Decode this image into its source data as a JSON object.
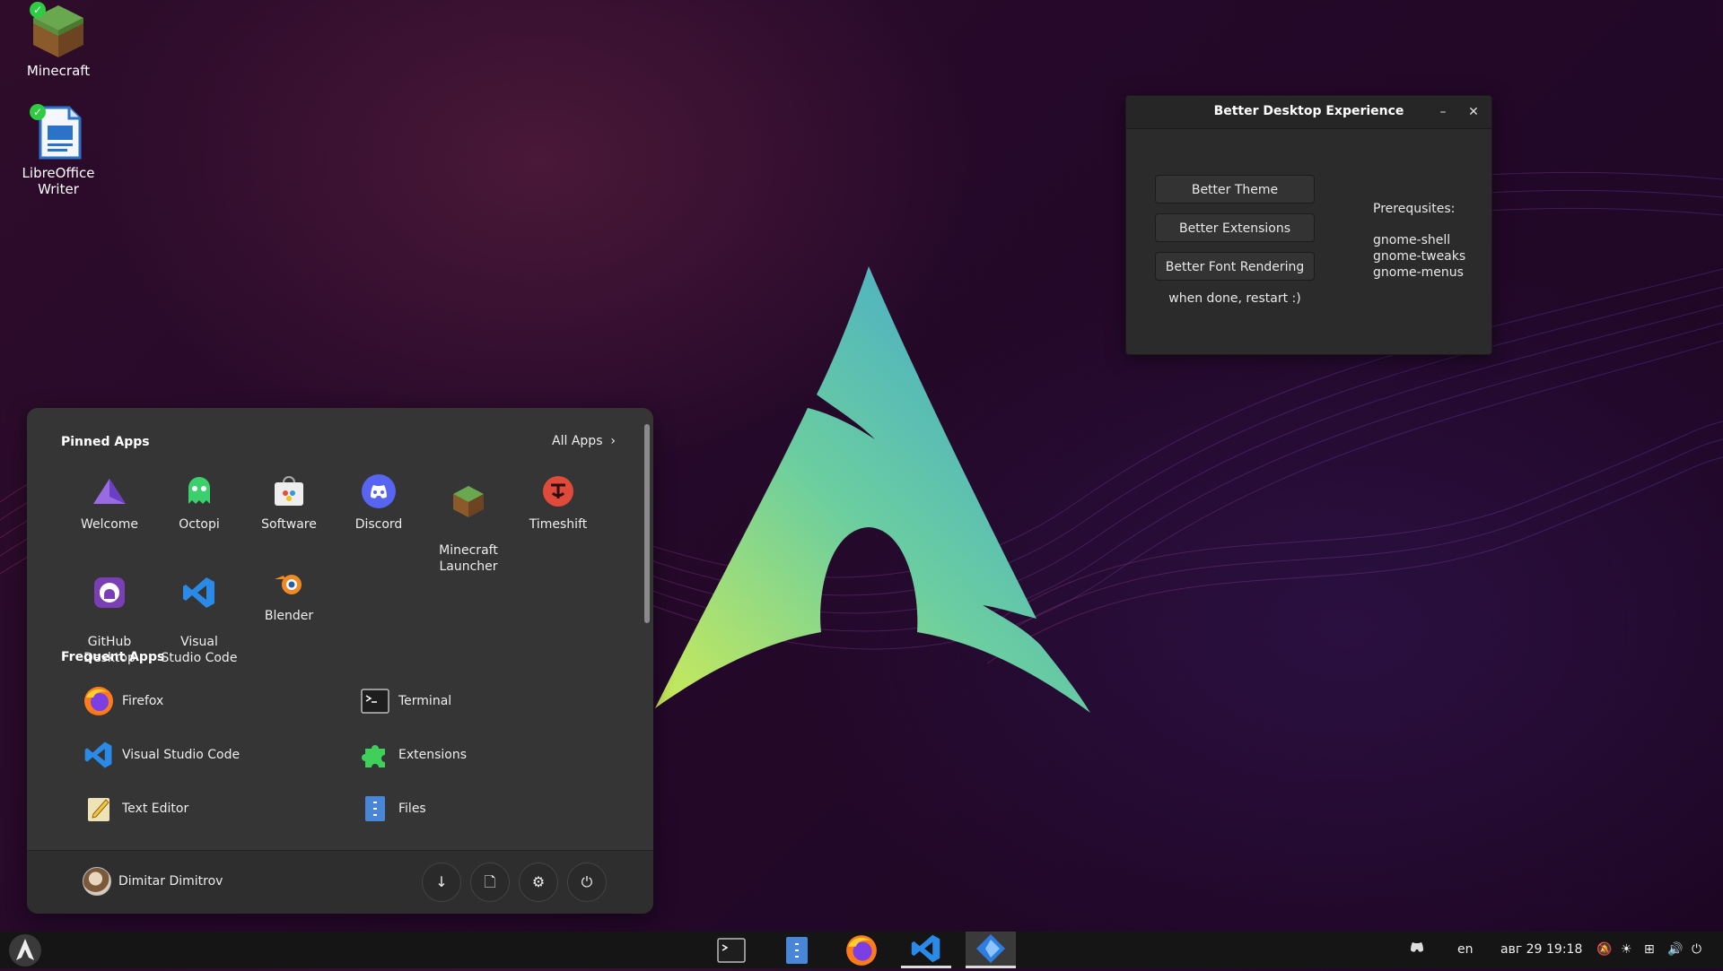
{
  "desktop": {
    "icons": [
      {
        "label": "Minecraft",
        "icon": "minecraft-grass-block-icon"
      },
      {
        "label": "LibreOffice Writer",
        "icon": "libreoffice-writer-icon"
      }
    ]
  },
  "dialog": {
    "title": "Better Desktop Experience",
    "minimize_label": "–",
    "close_label": "✕",
    "buttons": [
      "Better Theme",
      "Better Extensions",
      "Better Font Rendering"
    ],
    "note": "when done, restart :)",
    "prereq_title": "Prerequsites:",
    "prereqs": [
      "gnome-shell",
      "gnome-tweaks",
      "gnome-menus"
    ]
  },
  "menu": {
    "pinned_title": "Pinned Apps",
    "all_apps_label": "All Apps",
    "pinned": [
      {
        "label": "Welcome",
        "icon": "welcome-triangle-icon"
      },
      {
        "label": "Octopi",
        "icon": "octopi-icon"
      },
      {
        "label": "Software",
        "icon": "software-bag-icon"
      },
      {
        "label": "Discord",
        "icon": "discord-icon"
      },
      {
        "label": "Minecraft\nLauncher",
        "icon": "minecraft-icon"
      },
      {
        "label": "Timeshift",
        "icon": "timeshift-icon"
      },
      {
        "label": "GitHub\nDesktop",
        "icon": "github-icon"
      },
      {
        "label": "Visual\nStudio Code",
        "icon": "vscode-icon"
      },
      {
        "label": "Blender",
        "icon": "blender-icon"
      }
    ],
    "frequent_title": "Frequent Apps",
    "frequent": [
      {
        "label": "Firefox",
        "icon": "firefox-icon"
      },
      {
        "label": "Terminal",
        "icon": "terminal-icon"
      },
      {
        "label": "Visual Studio Code",
        "icon": "vscode-icon"
      },
      {
        "label": "Extensions",
        "icon": "extensions-puzzle-icon"
      },
      {
        "label": "Text Editor",
        "icon": "text-editor-icon"
      },
      {
        "label": "Files",
        "icon": "files-icon"
      }
    ],
    "user_name": "Dimitar Dimitrov",
    "footer_buttons": [
      "downloads-icon",
      "documents-icon",
      "settings-icon",
      "power-icon"
    ]
  },
  "taskbar": {
    "apps": [
      "terminal-icon",
      "files-icon",
      "firefox-icon",
      "vscode-icon",
      "extension-app-icon"
    ],
    "language": "en",
    "date": "авг 29",
    "time": "19:18"
  },
  "colors": {
    "accent": "#3b6fd9",
    "panel": "#353535",
    "taskbar": "#151515"
  }
}
